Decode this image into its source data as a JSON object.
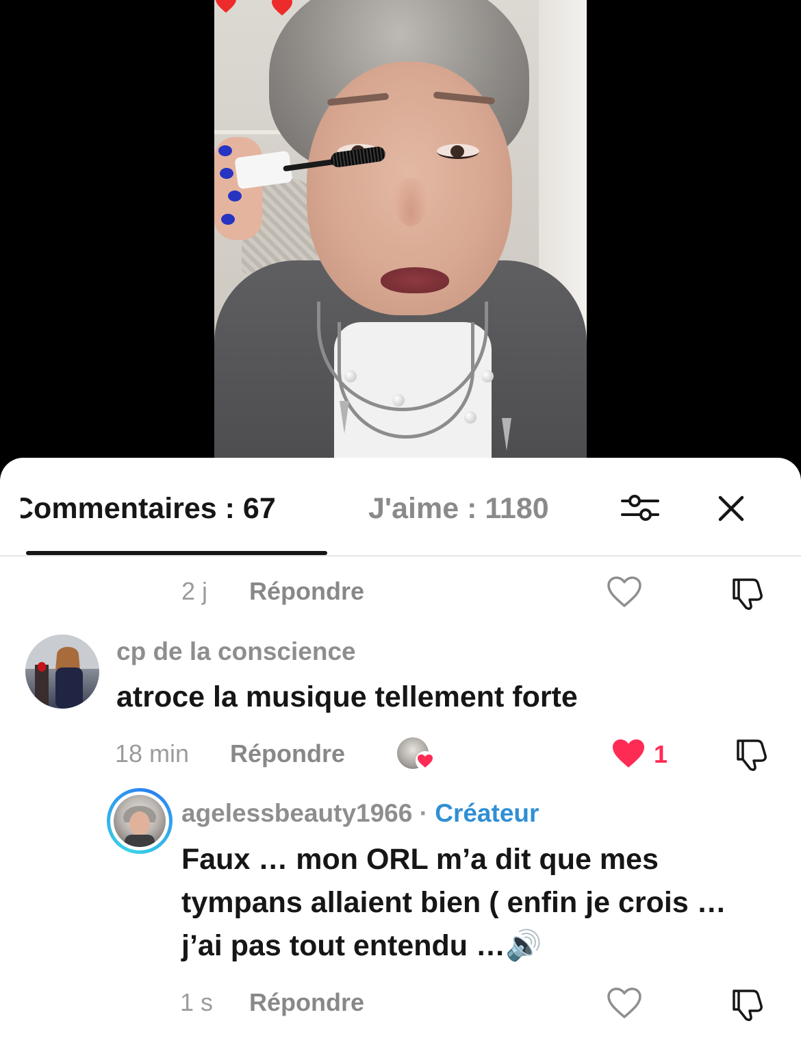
{
  "tabs": {
    "comments_label": "Commentaires : 67",
    "likes_label": "J'aime : 1180"
  },
  "comments": [
    {
      "time": "2 j",
      "reply_label": "Répondre"
    },
    {
      "username": "cp de la conscience",
      "text": "atroce la musique tellement forte",
      "time": "18 min",
      "reply_label": "Répondre",
      "like_count": "1",
      "liked": true,
      "creator_liked": true
    }
  ],
  "reply": {
    "username": "agelessbeauty1966",
    "separator": " · ",
    "badge": "Créateur",
    "text": "Faux … mon ORL m’a dit que mes tympans allaient bien ( enfin je crois … j’ai pas tout entendu …🔊",
    "time": "1 s",
    "reply_label": "Répondre"
  },
  "colors": {
    "accent_like": "#fe2c55",
    "creator_badge": "#2f8fd4",
    "story_ring_start": "#3ad4e6",
    "story_ring_end": "#2b7ff2"
  },
  "icons": [
    "heart-icon",
    "dislike-icon",
    "filter-icon",
    "close-icon",
    "speaker-icon"
  ]
}
